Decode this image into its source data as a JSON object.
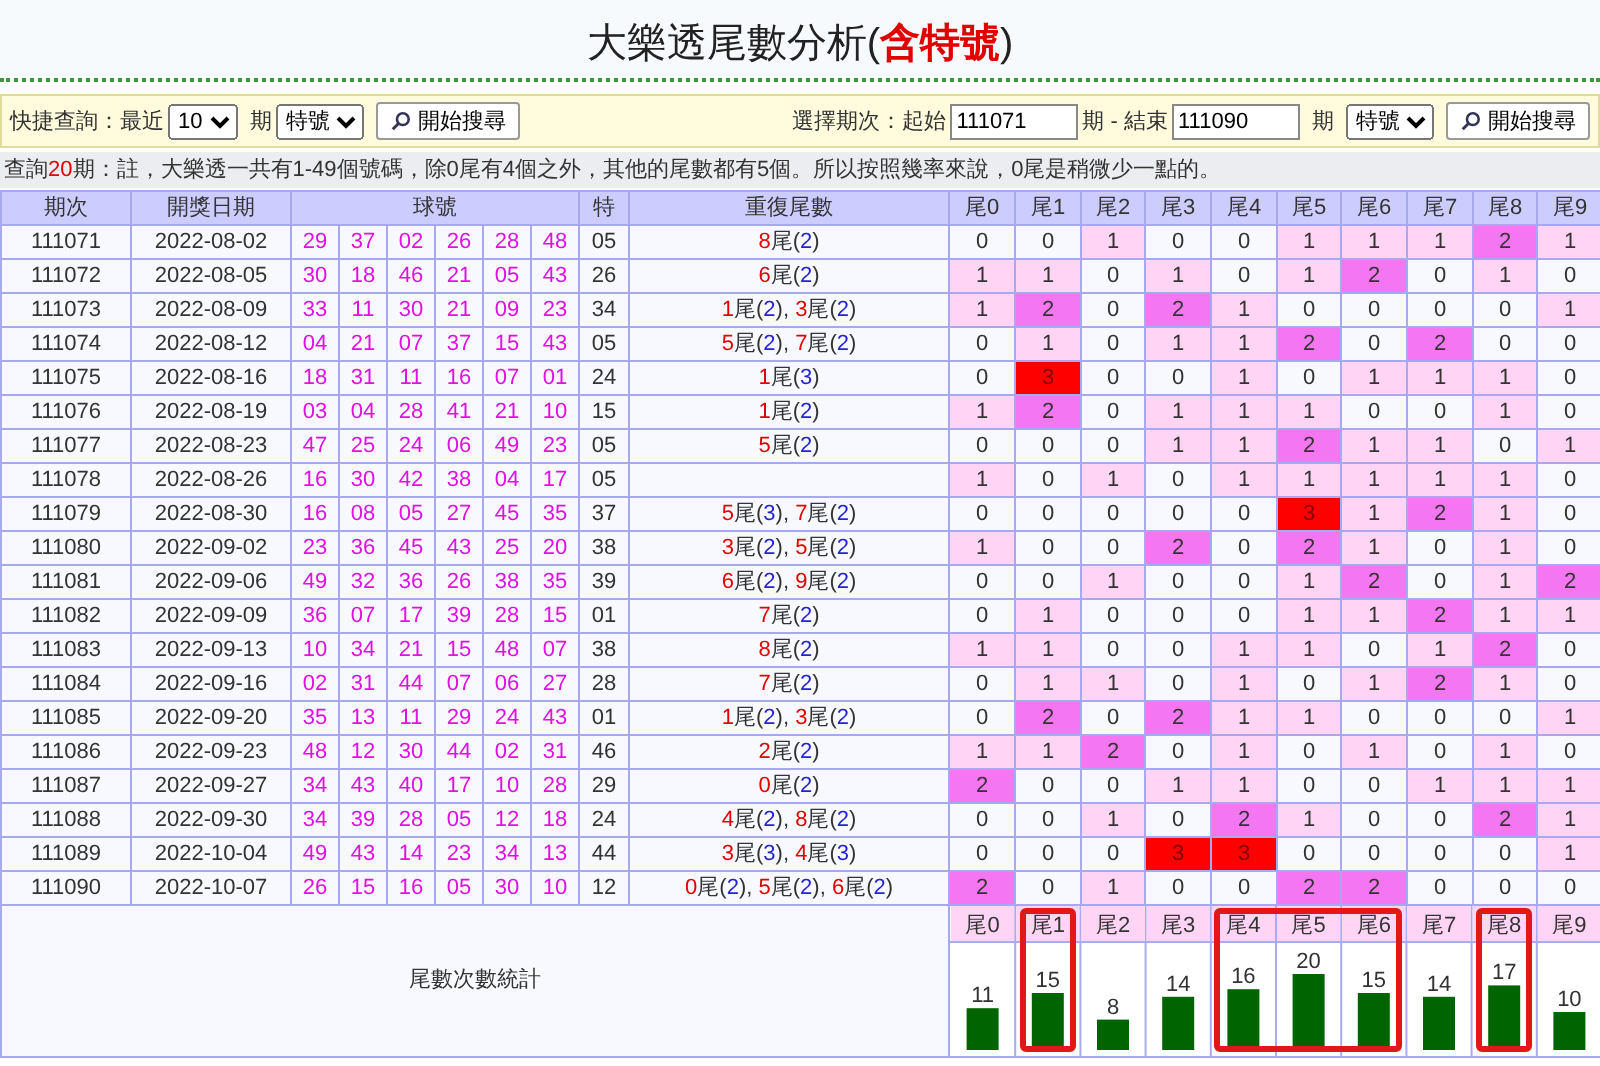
{
  "title": {
    "text": "大樂透尾數分析(",
    "highlight": "含特號",
    "end": ")"
  },
  "quick_search": {
    "label": "快捷查詢：最近",
    "count": "10",
    "unit": "期",
    "type": "特號",
    "button": "開始搜尋"
  },
  "range_search": {
    "label": "選擇期次：起始",
    "start": "111071",
    "middle": "期 - 結束",
    "end": "111090",
    "unit": "期",
    "type": "特號",
    "button": "開始搜尋"
  },
  "note": {
    "prefix": "查詢",
    "count": "20",
    "text": "期：註，大樂透一共有1-49個號碼，除0尾有4個之外，其他的尾數都有5個。所以按照幾率來說，0尾是稍微少一點的。"
  },
  "columns": [
    "期次",
    "開獎日期",
    "球號",
    "特",
    "重復尾數",
    "尾0",
    "尾1",
    "尾2",
    "尾3",
    "尾4",
    "尾5",
    "尾6",
    "尾7",
    "尾8",
    "尾9"
  ],
  "rows": [
    {
      "period": "111071",
      "date": "2022-08-02",
      "balls": [
        "29",
        "37",
        "02",
        "26",
        "28",
        "48"
      ],
      "special": "05",
      "repeats": [
        {
          "tail": "8",
          "unit": "尾(",
          "count": "2",
          "end": ")"
        }
      ],
      "tails": [
        "0",
        "0",
        "1",
        "0",
        "0",
        "1",
        "1",
        "1",
        "2",
        "1"
      ]
    },
    {
      "period": "111072",
      "date": "2022-08-05",
      "balls": [
        "30",
        "18",
        "46",
        "21",
        "05",
        "43"
      ],
      "special": "26",
      "repeats": [
        {
          "tail": "6",
          "unit": "尾(",
          "count": "2",
          "end": ")"
        }
      ],
      "tails": [
        "1",
        "1",
        "0",
        "1",
        "0",
        "1",
        "2",
        "0",
        "1",
        "0"
      ]
    },
    {
      "period": "111073",
      "date": "2022-08-09",
      "balls": [
        "33",
        "11",
        "30",
        "21",
        "09",
        "23"
      ],
      "special": "34",
      "repeats": [
        {
          "tail": "1",
          "unit": "尾(",
          "count": "2",
          "end": "), "
        },
        {
          "tail": "3",
          "unit": "尾(",
          "count": "2",
          "end": ")"
        }
      ],
      "tails": [
        "1",
        "2",
        "0",
        "2",
        "1",
        "0",
        "0",
        "0",
        "0",
        "1"
      ]
    },
    {
      "period": "111074",
      "date": "2022-08-12",
      "balls": [
        "04",
        "21",
        "07",
        "37",
        "15",
        "43"
      ],
      "special": "05",
      "repeats": [
        {
          "tail": "5",
          "unit": "尾(",
          "count": "2",
          "end": "), "
        },
        {
          "tail": "7",
          "unit": "尾(",
          "count": "2",
          "end": ")"
        }
      ],
      "tails": [
        "0",
        "1",
        "0",
        "1",
        "1",
        "2",
        "0",
        "2",
        "0",
        "0"
      ]
    },
    {
      "period": "111075",
      "date": "2022-08-16",
      "balls": [
        "18",
        "31",
        "11",
        "16",
        "07",
        "01"
      ],
      "special": "24",
      "repeats": [
        {
          "tail": "1",
          "unit": "尾(",
          "count": "3",
          "end": ")"
        }
      ],
      "tails": [
        "0",
        "3",
        "0",
        "0",
        "1",
        "0",
        "1",
        "1",
        "1",
        "0"
      ]
    },
    {
      "period": "111076",
      "date": "2022-08-19",
      "balls": [
        "03",
        "04",
        "28",
        "41",
        "21",
        "10"
      ],
      "special": "15",
      "repeats": [
        {
          "tail": "1",
          "unit": "尾(",
          "count": "2",
          "end": ")"
        }
      ],
      "tails": [
        "1",
        "2",
        "0",
        "1",
        "1",
        "1",
        "0",
        "0",
        "1",
        "0"
      ]
    },
    {
      "period": "111077",
      "date": "2022-08-23",
      "balls": [
        "47",
        "25",
        "24",
        "06",
        "49",
        "23"
      ],
      "special": "05",
      "repeats": [
        {
          "tail": "5",
          "unit": "尾(",
          "count": "2",
          "end": ")"
        }
      ],
      "tails": [
        "0",
        "0",
        "0",
        "1",
        "1",
        "2",
        "1",
        "1",
        "0",
        "1"
      ]
    },
    {
      "period": "111078",
      "date": "2022-08-26",
      "balls": [
        "16",
        "30",
        "42",
        "38",
        "04",
        "17"
      ],
      "special": "05",
      "repeats": [],
      "tails": [
        "1",
        "0",
        "1",
        "0",
        "1",
        "1",
        "1",
        "1",
        "1",
        "0"
      ]
    },
    {
      "period": "111079",
      "date": "2022-08-30",
      "balls": [
        "16",
        "08",
        "05",
        "27",
        "45",
        "35"
      ],
      "special": "37",
      "repeats": [
        {
          "tail": "5",
          "unit": "尾(",
          "count": "3",
          "end": "), "
        },
        {
          "tail": "7",
          "unit": "尾(",
          "count": "2",
          "end": ")"
        }
      ],
      "tails": [
        "0",
        "0",
        "0",
        "0",
        "0",
        "3",
        "1",
        "2",
        "1",
        "0"
      ]
    },
    {
      "period": "111080",
      "date": "2022-09-02",
      "balls": [
        "23",
        "36",
        "45",
        "43",
        "25",
        "20"
      ],
      "special": "38",
      "repeats": [
        {
          "tail": "3",
          "unit": "尾(",
          "count": "2",
          "end": "), "
        },
        {
          "tail": "5",
          "unit": "尾(",
          "count": "2",
          "end": ")"
        }
      ],
      "tails": [
        "1",
        "0",
        "0",
        "2",
        "0",
        "2",
        "1",
        "0",
        "1",
        "0"
      ]
    },
    {
      "period": "111081",
      "date": "2022-09-06",
      "balls": [
        "49",
        "32",
        "36",
        "26",
        "38",
        "35"
      ],
      "special": "39",
      "repeats": [
        {
          "tail": "6",
          "unit": "尾(",
          "count": "2",
          "end": "), "
        },
        {
          "tail": "9",
          "unit": "尾(",
          "count": "2",
          "end": ")"
        }
      ],
      "tails": [
        "0",
        "0",
        "1",
        "0",
        "0",
        "1",
        "2",
        "0",
        "1",
        "2"
      ]
    },
    {
      "period": "111082",
      "date": "2022-09-09",
      "balls": [
        "36",
        "07",
        "17",
        "39",
        "28",
        "15"
      ],
      "special": "01",
      "repeats": [
        {
          "tail": "7",
          "unit": "尾(",
          "count": "2",
          "end": ")"
        }
      ],
      "tails": [
        "0",
        "1",
        "0",
        "0",
        "0",
        "1",
        "1",
        "2",
        "1",
        "1"
      ]
    },
    {
      "period": "111083",
      "date": "2022-09-13",
      "balls": [
        "10",
        "34",
        "21",
        "15",
        "48",
        "07"
      ],
      "special": "38",
      "repeats": [
        {
          "tail": "8",
          "unit": "尾(",
          "count": "2",
          "end": ")"
        }
      ],
      "tails": [
        "1",
        "1",
        "0",
        "0",
        "1",
        "1",
        "0",
        "1",
        "2",
        "0"
      ]
    },
    {
      "period": "111084",
      "date": "2022-09-16",
      "balls": [
        "02",
        "31",
        "44",
        "07",
        "06",
        "27"
      ],
      "special": "28",
      "repeats": [
        {
          "tail": "7",
          "unit": "尾(",
          "count": "2",
          "end": ")"
        }
      ],
      "tails": [
        "0",
        "1",
        "1",
        "0",
        "1",
        "0",
        "1",
        "2",
        "1",
        "0"
      ]
    },
    {
      "period": "111085",
      "date": "2022-09-20",
      "balls": [
        "35",
        "13",
        "11",
        "29",
        "24",
        "43"
      ],
      "special": "01",
      "repeats": [
        {
          "tail": "1",
          "unit": "尾(",
          "count": "2",
          "end": "), "
        },
        {
          "tail": "3",
          "unit": "尾(",
          "count": "2",
          "end": ")"
        }
      ],
      "tails": [
        "0",
        "2",
        "0",
        "2",
        "1",
        "1",
        "0",
        "0",
        "0",
        "1"
      ]
    },
    {
      "period": "111086",
      "date": "2022-09-23",
      "balls": [
        "48",
        "12",
        "30",
        "44",
        "02",
        "31"
      ],
      "special": "46",
      "repeats": [
        {
          "tail": "2",
          "unit": "尾(",
          "count": "2",
          "end": ")"
        }
      ],
      "tails": [
        "1",
        "1",
        "2",
        "0",
        "1",
        "0",
        "1",
        "0",
        "1",
        "0"
      ]
    },
    {
      "period": "111087",
      "date": "2022-09-27",
      "balls": [
        "34",
        "43",
        "40",
        "17",
        "10",
        "28"
      ],
      "special": "29",
      "repeats": [
        {
          "tail": "0",
          "unit": "尾(",
          "count": "2",
          "end": ")"
        }
      ],
      "tails": [
        "2",
        "0",
        "0",
        "1",
        "1",
        "0",
        "0",
        "1",
        "1",
        "1"
      ]
    },
    {
      "period": "111088",
      "date": "2022-09-30",
      "balls": [
        "34",
        "39",
        "28",
        "05",
        "12",
        "18"
      ],
      "special": "24",
      "repeats": [
        {
          "tail": "4",
          "unit": "尾(",
          "count": "2",
          "end": "), "
        },
        {
          "tail": "8",
          "unit": "尾(",
          "count": "2",
          "end": ")"
        }
      ],
      "tails": [
        "0",
        "0",
        "1",
        "0",
        "2",
        "1",
        "0",
        "0",
        "2",
        "1"
      ]
    },
    {
      "period": "111089",
      "date": "2022-10-04",
      "balls": [
        "49",
        "43",
        "14",
        "23",
        "34",
        "13"
      ],
      "special": "44",
      "repeats": [
        {
          "tail": "3",
          "unit": "尾(",
          "count": "3",
          "end": "), "
        },
        {
          "tail": "4",
          "unit": "尾(",
          "count": "3",
          "end": ")"
        }
      ],
      "tails": [
        "0",
        "0",
        "0",
        "3",
        "3",
        "0",
        "0",
        "0",
        "0",
        "1"
      ]
    },
    {
      "period": "111090",
      "date": "2022-10-07",
      "balls": [
        "26",
        "15",
        "16",
        "05",
        "30",
        "10"
      ],
      "special": "12",
      "repeats": [
        {
          "tail": "0",
          "unit": "尾(",
          "count": "2",
          "end": "), "
        },
        {
          "tail": "5",
          "unit": "尾(",
          "count": "2",
          "end": "), "
        },
        {
          "tail": "6",
          "unit": "尾(",
          "count": "2",
          "end": ")"
        }
      ],
      "tails": [
        "2",
        "0",
        "1",
        "0",
        "0",
        "2",
        "2",
        "0",
        "0",
        "0"
      ]
    }
  ],
  "summary": {
    "frames": [
      false,
      true,
      false,
      false,
      true,
      true,
      true,
      false,
      true,
      false
    ],
    "chart_data": {
      "type": "bar",
      "title": "尾數次數統計",
      "categories": [
        "尾0",
        "尾1",
        "尾2",
        "尾3",
        "尾4",
        "尾5",
        "尾6",
        "尾7",
        "尾8",
        "尾9"
      ],
      "series": [
        {
          "color": "#006400",
          "values": [
            11,
            15,
            8,
            14,
            16,
            20,
            15,
            14,
            17,
            10
          ]
        }
      ],
      "data_labels": true
    }
  }
}
